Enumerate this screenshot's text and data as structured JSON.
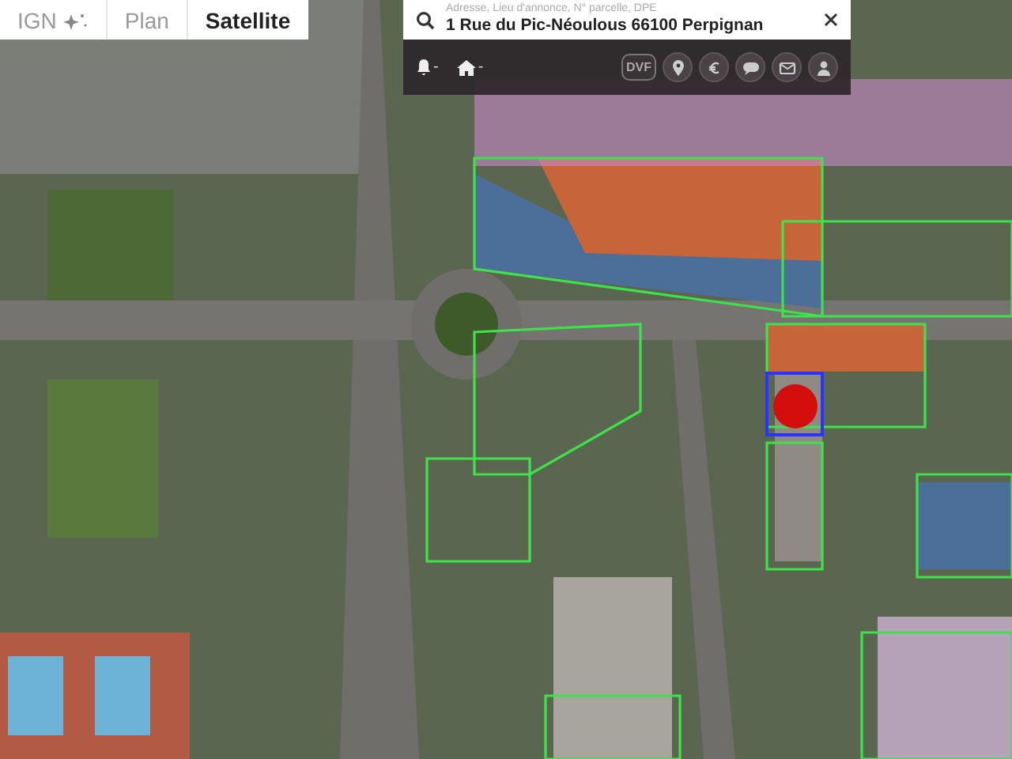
{
  "map_tabs": [
    {
      "label": "IGN",
      "kind": "ign",
      "selected": false
    },
    {
      "label": "Plan",
      "kind": "plain",
      "selected": false
    },
    {
      "label": "Satellite",
      "kind": "plain",
      "selected": true
    }
  ],
  "search": {
    "label": "Adresse, Lieu d'annonce, N° parcelle, DPE",
    "value": "1 Rue du Pic-Néoulous 66100 Perpignan"
  },
  "toolbar": {
    "alerts": "-",
    "homes": "-",
    "dvf": "DVF",
    "buttons": [
      {
        "kind": "pin"
      },
      {
        "kind": "euro"
      },
      {
        "kind": "chat"
      },
      {
        "kind": "mail"
      },
      {
        "kind": "person"
      }
    ]
  }
}
